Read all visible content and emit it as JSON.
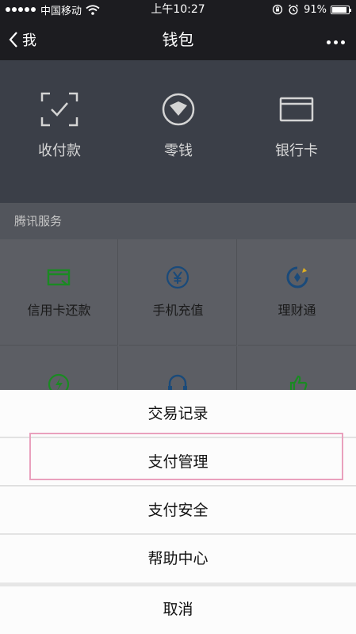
{
  "status_bar": {
    "carrier": "中国移动",
    "time": "上午10:27",
    "battery": "91%",
    "battery_level": 0.91
  },
  "nav": {
    "back_label": "我",
    "title": "钱包",
    "back_icon": "chevron-left-icon",
    "more_icon": "more-dots-icon"
  },
  "top_actions": [
    {
      "label": "收付款",
      "icon": "scan-pay-icon"
    },
    {
      "label": "零钱",
      "icon": "wallet-coin-icon"
    },
    {
      "label": "银行卡",
      "icon": "bank-card-icon"
    }
  ],
  "section": {
    "title": "腾讯服务"
  },
  "services": [
    {
      "label": "信用卡还款",
      "icon": "credit-card-icon"
    },
    {
      "label": "手机充值",
      "icon": "yen-coin-icon"
    },
    {
      "label": "理财通",
      "icon": "wealth-icon"
    },
    {
      "label": "",
      "icon": "lightning-icon"
    },
    {
      "label": "",
      "icon": "headset-icon"
    },
    {
      "label": "",
      "icon": "thumb-up-icon"
    }
  ],
  "action_sheet": {
    "items": [
      "交易记录",
      "支付管理",
      "支付安全",
      "帮助中心"
    ],
    "cancel": "取消",
    "highlighted_item": "支付管理"
  },
  "colors": {
    "accent_green": "#1aad19",
    "highlight_pink": "#e9a0bd"
  }
}
